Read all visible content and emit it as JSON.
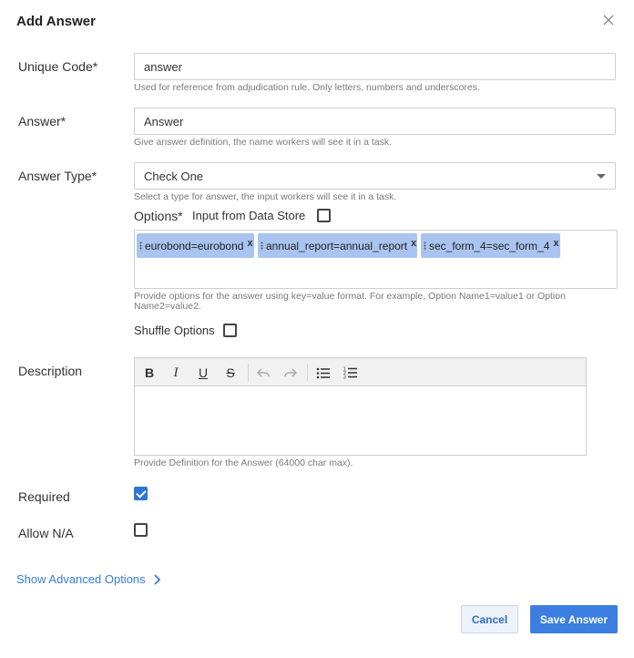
{
  "dialog": {
    "title": "Add Answer"
  },
  "unique_code": {
    "label": "Unique Code*",
    "value": "answer",
    "hint": "Used for reference from adjudication rule. Only letters, numbers and underscores."
  },
  "answer": {
    "label": "Answer*",
    "value": "Answer",
    "hint": "Give answer definition, the name workers will see it in a task."
  },
  "answer_type": {
    "label": "Answer Type*",
    "selected": "Check One",
    "hint": "Select a type for answer, the input workers will see it in a task."
  },
  "options": {
    "label": "Options*",
    "data_store_label": "Input from Data Store",
    "data_store_checked": false,
    "tags": [
      "eurobond=eurobond",
      "annual_report=annual_report",
      "sec_form_4=sec_form_4"
    ],
    "tag_remove": "x",
    "hint_line1": "Provide options for the answer using key=value format. For example, Option Name1=value1 or Option",
    "hint_line2": "Name2=value2.",
    "shuffle_label": "Shuffle Options",
    "shuffle_checked": false
  },
  "description": {
    "label": "Description",
    "toolbar": {
      "bold": "B",
      "italic": "I",
      "underline": "U",
      "strike": "S"
    },
    "hint": "Provide Definition for the Answer (64000 char max)."
  },
  "required": {
    "label": "Required",
    "checked": true
  },
  "allow_na": {
    "label": "Allow N/A",
    "checked": false
  },
  "advanced": {
    "label": "Show Advanced Options"
  },
  "footer": {
    "cancel": "Cancel",
    "save": "Save Answer"
  },
  "colors": {
    "primary": "#3b7ee0",
    "tag_bg": "#a9c4f0",
    "link": "#3b7dd8"
  }
}
